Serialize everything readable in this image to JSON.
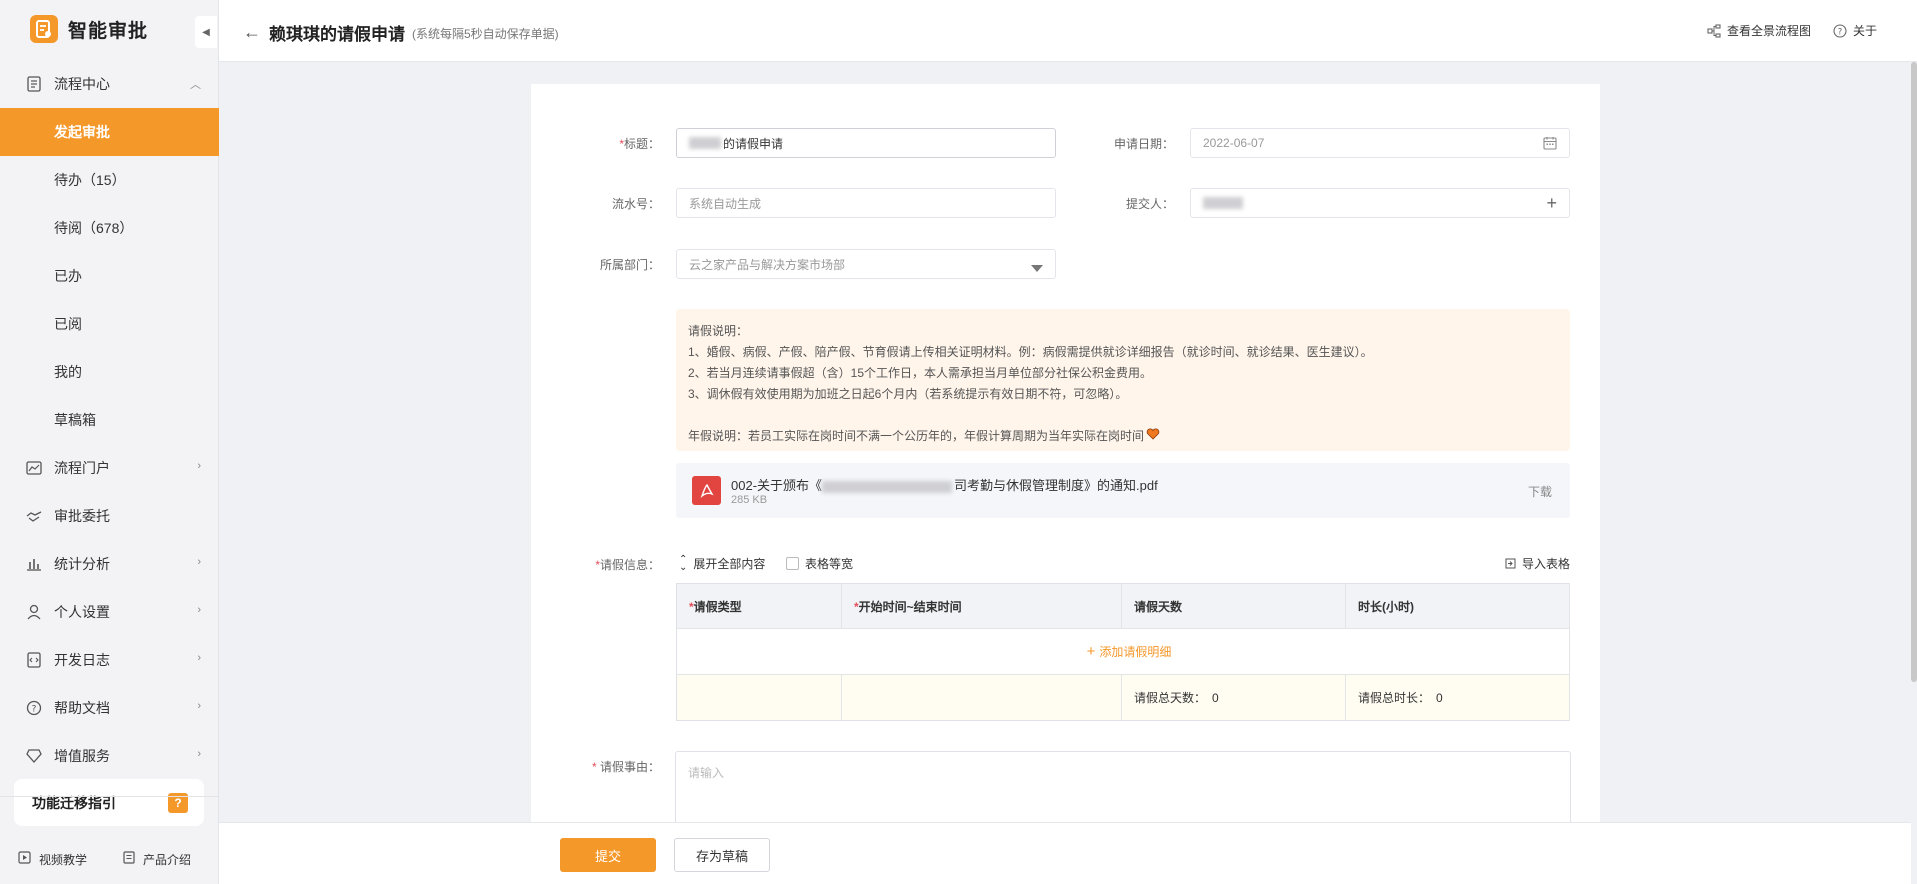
{
  "app": {
    "title": "智能审批"
  },
  "sidebar": {
    "groups": [
      {
        "label": "流程中心",
        "icon": "document-icon"
      },
      {
        "label": "流程门户",
        "icon": "portal-icon"
      },
      {
        "label": "审批委托",
        "icon": "handshake-icon"
      },
      {
        "label": "统计分析",
        "icon": "bar-chart-icon"
      },
      {
        "label": "个人设置",
        "icon": "user-icon"
      },
      {
        "label": "开发日志",
        "icon": "code-icon"
      },
      {
        "label": "帮助文档",
        "icon": "question-icon"
      },
      {
        "label": "增值服务",
        "icon": "diamond-icon"
      }
    ],
    "subitems": [
      "发起审批",
      "待办（15）",
      "待阅（678）",
      "已办",
      "已阅",
      "我的",
      "草稿箱"
    ],
    "guide_label": "功能迁移指引",
    "guide_badge": "?",
    "footer": {
      "video": "视频教学",
      "product": "产品介绍"
    }
  },
  "header": {
    "title": "赖琪琪的请假申请",
    "autosave": "(系统每隔5秒自动保存单据)",
    "view_flow": "查看全景流程图",
    "about": "关于"
  },
  "form": {
    "title_label": "标题：",
    "title_value": "的请假申请",
    "date_label": "申请日期：",
    "date_value": "2022-06-07",
    "serial_label": "流水号：",
    "serial_placeholder": "系统自动生成",
    "submitter_label": "提交人：",
    "dept_label": "所属部门：",
    "dept_value": "云之家产品与解决方案市场部",
    "notice_lines": [
      "请假说明：",
      "1、婚假、病假、产假、陪产假、节育假请上传相关证明材料。例：病假需提供就诊详细报告（就诊时间、就诊结果、医生建议）。",
      "2、若当月连续请事假超（含）15个工作日，本人需承担当月单位部分社保公积金费用。",
      "3、调休假有效使用期为加班之日起6个月内（若系统提示有效日期不符，可忽略）。",
      "",
      "年假说明：若员工实际在岗时间不满一个公历年的，年假计算周期为当年实际在岗时间"
    ],
    "attachment": {
      "name_prefix": "002-关于颁布《",
      "name_suffix": "司考勤与休假管理制度》的通知.pdf",
      "size": "285 KB",
      "download": "下载"
    },
    "leave_info_label": "请假信息：",
    "expand_all": "展开全部内容",
    "table_equal_width": "表格等宽",
    "import_table": "导入表格",
    "table_headers": [
      "请假类型",
      "开始时间~结束时间",
      "请假天数",
      "时长(小时)"
    ],
    "add_detail": "添加请假明细",
    "total_days_label": "请假总天数：",
    "total_days": "0",
    "total_hours_label": "请假总时长：",
    "total_hours": "0",
    "reason_label": "请假事由：",
    "reason_placeholder": "请输入"
  },
  "actions": {
    "submit": "提交",
    "save_draft": "存为草稿"
  },
  "colors": {
    "accent": "#f5982a",
    "required": "#e34d59",
    "notice_bg": "#fff5eb"
  }
}
